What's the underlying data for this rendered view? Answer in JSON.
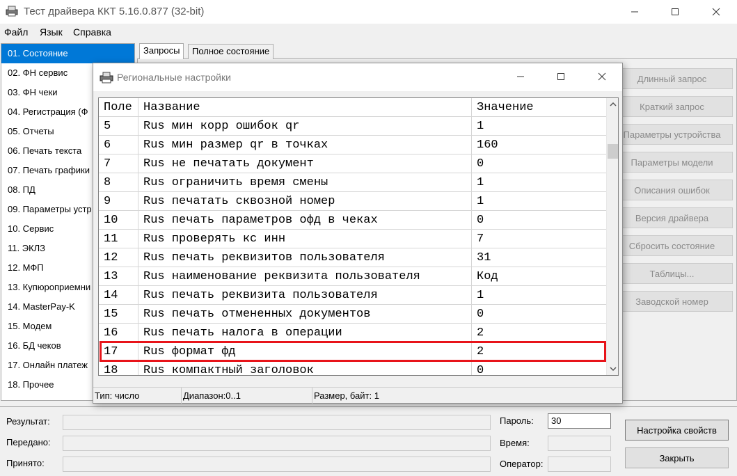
{
  "window": {
    "title": "Тест драйвера ККТ 5.16.0.877 (32-bit)",
    "icon": "printer-app-icon"
  },
  "menu": [
    "Файл",
    "Язык",
    "Справка"
  ],
  "left_list": {
    "selected_index": 0,
    "items": [
      "01. Состояние",
      "02. ФН сервис",
      "03. ФН чеки",
      "04. Регистрация (Ф",
      "05. Отчеты",
      "06. Печать текста",
      "07. Печать графики",
      "08. ПД",
      "09. Параметры устр",
      "10. Сервис",
      "11. ЭКЛЗ",
      "12. МФП",
      "13. Купюроприемни",
      "14. MasterPay-K",
      "15. Модем",
      "16. БД чеков",
      "17. Онлайн платеж",
      "18. Прочее"
    ]
  },
  "tabs": [
    "Запросы",
    "Полное состояние"
  ],
  "right_buttons": [
    "Длинный запрос",
    "Краткий запрос",
    "Параметры устройства",
    "Параметры модели",
    "Описания ошибок",
    "Версия драйвера",
    "Сбросить состояние",
    "Таблицы...",
    "Заводской номер"
  ],
  "bottom": {
    "result_label": "Результат:",
    "sent_label": "Передано:",
    "received_label": "Принято:",
    "password_label": "Пароль:",
    "password_value": "30",
    "time_label": "Время:",
    "operator_label": "Оператор:",
    "settings_button": "Настройка свойств",
    "close_button": "Закрыть"
  },
  "dialog": {
    "title": "Региональные настройки",
    "columns": [
      "Поле",
      "Название",
      "Значение"
    ],
    "rows": [
      [
        "5",
        "Rus мин корр ошибок qr",
        "1"
      ],
      [
        "6",
        "Rus мин размер qr в точках",
        "160"
      ],
      [
        "7",
        "Rus не печатать документ",
        "0"
      ],
      [
        "8",
        "Rus ограничить время смены",
        "1"
      ],
      [
        "9",
        "Rus печатать сквозной номер",
        "1"
      ],
      [
        "10",
        "Rus печать параметров офд в чеках",
        "0"
      ],
      [
        "11",
        "Rus проверять кс инн",
        "7"
      ],
      [
        "12",
        "Rus печать реквизитов пользователя",
        "31"
      ],
      [
        "13",
        "Rus наименование реквизита пользователя",
        "Код"
      ],
      [
        "14",
        "Rus печать реквизита пользователя",
        "1"
      ],
      [
        "15",
        "Rus печать отмененных документов",
        "0"
      ],
      [
        "16",
        "Rus печать налога в операции",
        "2"
      ],
      [
        "17",
        "Rus формат фд",
        "2"
      ],
      [
        "18",
        "Rus компактный заголовок",
        "0"
      ]
    ],
    "highlighted_row_index": 12,
    "highlight_color": "#e8141a",
    "status": {
      "type": "Тип: число",
      "range": "Диапазон:0..1",
      "size": "Размер, байт: 1"
    }
  },
  "colors": {
    "selection": "#0078d7",
    "disabled_text": "#8a8a8a"
  }
}
